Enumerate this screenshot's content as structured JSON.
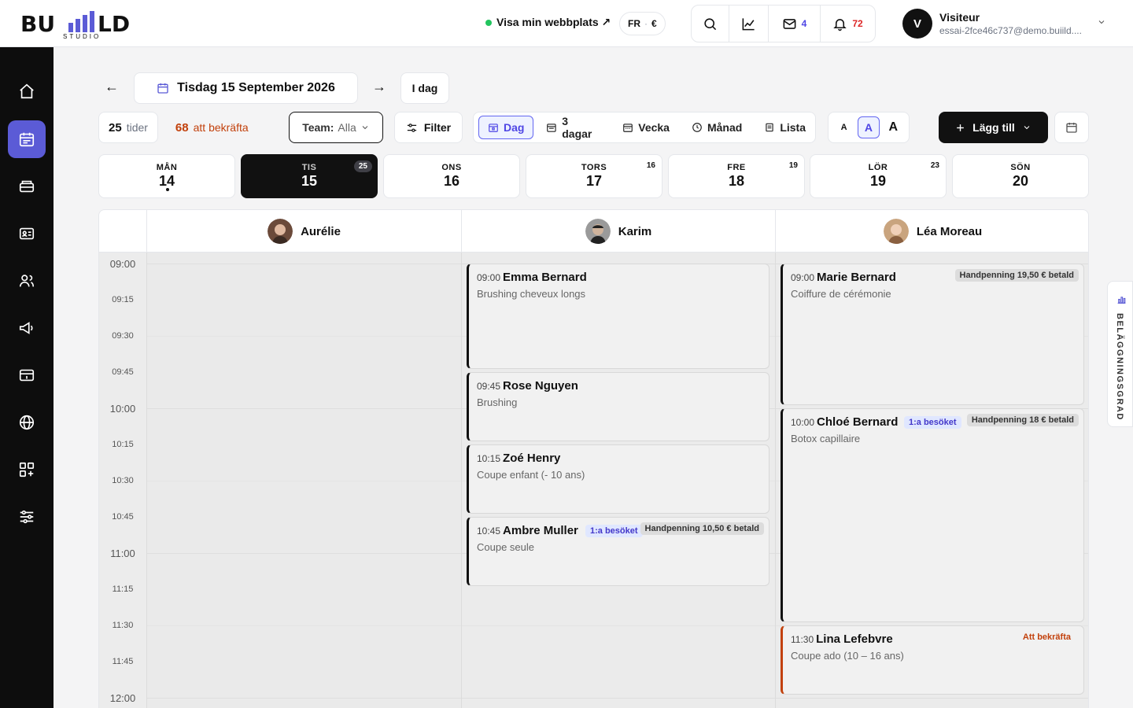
{
  "brand": {
    "logo_text": "BU   LD",
    "logo_sub": "STUDIO"
  },
  "header": {
    "site_link": "Visa min webbplats ↗",
    "lang": "FR",
    "currency": "€",
    "mail_count": "4",
    "notif_count": "72",
    "user_initial": "V",
    "user_name": "Visiteur",
    "user_email": "essai-2fce46c737@demo.buiild...."
  },
  "datenav": {
    "prev": "←",
    "next": "→",
    "date_label": "Tisdag 15 September 2026",
    "today_label": "I dag"
  },
  "toolbar": {
    "slots_count": "25",
    "slots_label": "tider",
    "confirm_count": "68",
    "confirm_label": "att bekräfta",
    "team_label": "Team:",
    "team_value": "Alla",
    "filter_label": "Filter",
    "views": [
      "Dag",
      "3 dagar",
      "Vecka",
      "Månad",
      "Lista"
    ],
    "font_sizes": [
      "A",
      "A",
      "A"
    ],
    "add_label": "Lägg till"
  },
  "week": [
    {
      "name": "MÅN",
      "num": "14",
      "badge": ""
    },
    {
      "name": "TIS",
      "num": "15",
      "badge": "25"
    },
    {
      "name": "ONS",
      "num": "16",
      "badge": ""
    },
    {
      "name": "TORS",
      "num": "17",
      "badge": "16"
    },
    {
      "name": "FRE",
      "num": "18",
      "badge": "19"
    },
    {
      "name": "LÖR",
      "num": "19",
      "badge": "23"
    },
    {
      "name": "SÖN",
      "num": "20",
      "badge": ""
    }
  ],
  "staff": [
    "Aurélie",
    "Karim",
    "Léa Moreau"
  ],
  "times": [
    "09:00",
    "09:15",
    "09:30",
    "09:45",
    "10:00",
    "10:15",
    "10:30",
    "10:45",
    "11:00",
    "11:15",
    "11:30",
    "11:45",
    "12:00"
  ],
  "appointments": {
    "karim": [
      {
        "time": "09:00",
        "name": "Emma Bernard",
        "service": "Brushing cheveux longs"
      },
      {
        "time": "09:45",
        "name": "Rose Nguyen",
        "service": "Brushing"
      },
      {
        "time": "10:15",
        "name": "Zoé Henry",
        "service": "Coupe enfant (- 10 ans)"
      },
      {
        "time": "10:45",
        "name": "Ambre Muller",
        "service": "Coupe seule",
        "first_visit": "1:a besöket",
        "deposit": "Handpenning 10,50 € betald"
      }
    ],
    "lea": [
      {
        "time": "09:00",
        "name": "Marie Bernard",
        "service": "Coiffure de cérémonie",
        "deposit": "Handpenning 19,50 € betald"
      },
      {
        "time": "10:00",
        "name": "Chloé Bernard",
        "service": "Botox capillaire",
        "first_visit": "1:a besöket",
        "deposit": "Handpenning 18 € betald"
      },
      {
        "time": "11:30",
        "name": "Lina Lefebvre",
        "service": "Coupe ado (10 – 16 ans)",
        "status": "Att bekräfta"
      }
    ]
  },
  "side_tab": "BELÄGGNINGSGRAD",
  "colors": {
    "accent": "#5b5bd6",
    "dark": "#111111",
    "warn": "#c2410c",
    "online": "#22c55e"
  }
}
